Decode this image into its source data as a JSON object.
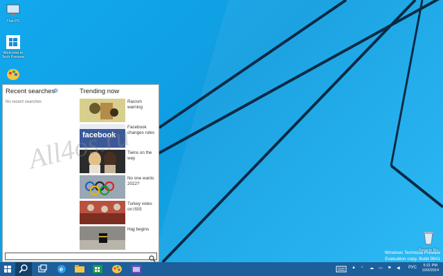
{
  "desktop": {
    "icons": [
      {
        "label": "This PC",
        "icon": "computer-icon"
      },
      {
        "label": "Welcome to Tech Preview",
        "icon": "windows-logo-icon"
      },
      {
        "label": "",
        "icon": "paint-icon"
      }
    ],
    "recycle_bin": {
      "label": "Recycle Bin",
      "icon": "recycle-bin-icon"
    },
    "watermark": "All4os.ru"
  },
  "search_panel": {
    "recent_title": "Recent searches",
    "recent_empty": "No recent searches",
    "trending_title": "Trending now",
    "trending": [
      {
        "text": "Racism warning"
      },
      {
        "text": "Facebook changes rules",
        "thumb_text": "facebook"
      },
      {
        "text": "Twins on the way"
      },
      {
        "text": "No one wants 2022?"
      },
      {
        "text": "Turkey votes on ISIS"
      },
      {
        "text": "Hajj begins"
      }
    ],
    "search_value": ""
  },
  "build_info": {
    "line1": "Windows Technical Preview",
    "line2": "Evaluation copy. Build 9841"
  },
  "taskbar": {
    "language": "РУС",
    "time": "5:21 PM",
    "date": "10/3/2014"
  },
  "colors": {
    "wallpaper": "#12a9ee",
    "taskbar": "#1c5f9a",
    "accent": "#2a6fd6"
  }
}
